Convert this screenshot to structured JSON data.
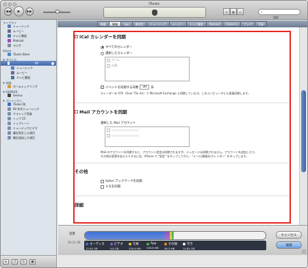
{
  "window": {
    "title": "iTunes"
  },
  "toolbar": {
    "prev_icon": "rewind-icon",
    "play_icon": "play-icon",
    "next_icon": "fast-forward-icon",
    "search_placeholder": "",
    "search_label": "検索"
  },
  "sidebar": {
    "sections": [
      {
        "heading": "ライブラリ",
        "items": [
          {
            "label": "ミュージック",
            "icon": "music-icon",
            "color": "#5b7fc2"
          },
          {
            "label": "ムービー",
            "icon": "movie-icon",
            "color": "#6a6a8a"
          },
          {
            "label": "テレビ番組",
            "icon": "tv-icon",
            "color": "#4d6f9e"
          },
          {
            "label": "Podcast",
            "icon": "podcast-icon",
            "color": "#9b4fb0"
          },
          {
            "label": "ラジオ",
            "icon": "radio-icon",
            "color": "#7f8b99"
          }
        ]
      },
      {
        "heading": "Store",
        "items": [
          {
            "label": "iTunes Store",
            "icon": "store-icon",
            "color": "#4f86c6"
          }
        ]
      },
      {
        "heading": "▼ デバイス",
        "items": []
      },
      {
        "heading": "",
        "items": [
          {
            "label": "ミュージック",
            "icon": "music-icon",
            "color": "#5b7fc2",
            "sub": true
          },
          {
            "label": "ムービー",
            "icon": "movie-icon",
            "color": "#6a6a8a",
            "sub": true
          },
          {
            "label": "テレビ番組",
            "icon": "tv-icon",
            "color": "#4d6f9e",
            "sub": true
          }
        ]
      },
      {
        "heading": "▼ 共有",
        "items": [
          {
            "label": "ホームシェアリング",
            "icon": "home-icon",
            "color": "#d69b3a"
          }
        ]
      },
      {
        "heading": "▼ GENIUS",
        "items": [
          {
            "label": "Genius",
            "icon": "genius-icon",
            "color": "#444"
          }
        ]
      },
      {
        "heading": "▼ プレイリスト",
        "items": [
          {
            "label": "iTunes DJ",
            "icon": "dj-icon",
            "color": "#3d6fc2"
          },
          {
            "label": "90 年代ミュージック",
            "icon": "smart-playlist-icon",
            "color": "#7c8fa8"
          },
          {
            "label": "クラシック音楽",
            "icon": "smart-playlist-icon",
            "color": "#7c8fa8"
          },
          {
            "label": "トップ 25",
            "icon": "smart-playlist-icon",
            "color": "#7c8fa8"
          },
          {
            "label": "トップレート",
            "icon": "smart-playlist-icon",
            "color": "#7c8fa8"
          },
          {
            "label": "ミュージックビデオ",
            "icon": "smart-playlist-icon",
            "color": "#7c8fa8"
          },
          {
            "label": "最近再生した項目",
            "icon": "smart-playlist-icon",
            "color": "#7c8fa8"
          },
          {
            "label": "最近追加した項目",
            "icon": "smart-playlist-icon",
            "color": "#7c8fa8"
          }
        ]
      }
    ],
    "device_badge": "80"
  },
  "tabs": [
    "概要",
    "情報",
    "App",
    "着信音",
    "ミュージック",
    "ムービー",
    "テレビ番組",
    "Podcast",
    "iTunes U",
    "ブック",
    "写真"
  ],
  "active_tab": "情報",
  "ical": {
    "title": "iCal カレンダーを同期",
    "checked": true,
    "all_label": "すべてのカレンダー",
    "selected_label": "選択したカレンダー",
    "calendars": [
      "ホーム",
      "仕事"
    ],
    "sync_events_label": "イベントを同期する日数",
    "days_value": "30",
    "days_unit": "日",
    "note": "カレンダーを OTA（Over The Air）で Microsoft Exchange と同期しています。このコンピュータとも直接同期します。"
  },
  "mail": {
    "title": "Mail アカウントを同期",
    "checked": false,
    "selected_label": "選択した Mail アカウント",
    "note1": "Mail のアカウントを同期すると、アカウント設定は同期されますが、メッセージは同期されません。アカウントを追加したり、",
    "note2": "その他の変更を加えたりするには、iPhone で \"設定\" をタップしてから、\"メール/連絡先/カレンダー\" をタップします。"
  },
  "other": {
    "title": "その他",
    "safari_label": "Safari ブックマークを同期",
    "notes_label": "メモを同期"
  },
  "advanced": {
    "title": "詳細"
  },
  "capacity": {
    "label": "容量",
    "total": "29.33 GB",
    "segments": [
      {
        "name": "オーディオ",
        "value": "12.95 GB",
        "color": "#3f72d6",
        "fraction": 0.44
      },
      {
        "name": "ビデオ",
        "value": "0.8 GB",
        "color": "#8a58c4",
        "fraction": 0.03
      },
      {
        "name": "写真",
        "value": "339.8 MB",
        "color": "#e6c035",
        "fraction": 0.012
      },
      {
        "name": "App",
        "value": "196.8 MB",
        "color": "#4fb048",
        "fraction": 0.007
      },
      {
        "name": "その他",
        "value": "48.3 MB",
        "color": "#e08a2c",
        "fraction": 0.002
      },
      {
        "name": "空き",
        "value": "14.85 GB",
        "color": "#f2f2f2",
        "fraction": 0.509
      }
    ]
  },
  "buttons": {
    "cancel": "キャンセル",
    "apply": "適用"
  }
}
